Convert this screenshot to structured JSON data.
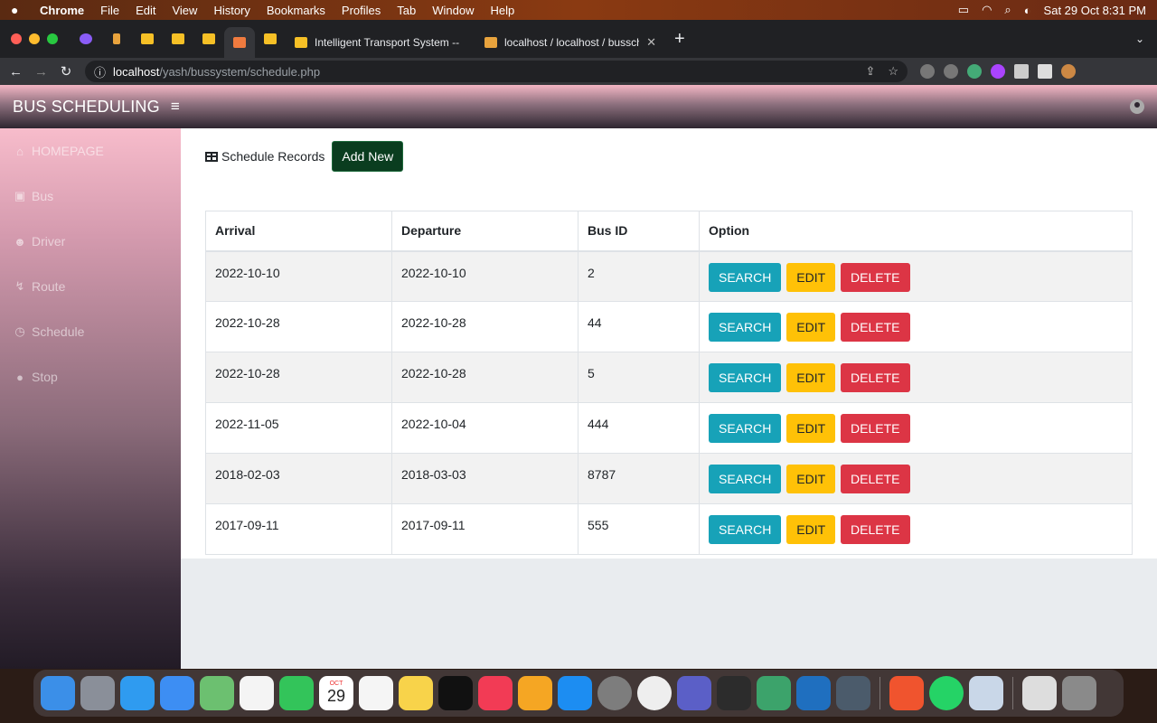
{
  "menubar": {
    "app": "Chrome",
    "items": [
      "File",
      "Edit",
      "View",
      "History",
      "Bookmarks",
      "Profiles",
      "Tab",
      "Window",
      "Help"
    ],
    "datetime": "Sat 29 Oct  8:31 PM"
  },
  "browser": {
    "tabs": [
      {
        "title": "Intelligent Transport System --"
      },
      {
        "title": "localhost / localhost / bussche"
      }
    ],
    "url_host": "localhost",
    "url_path": "/yash/bussystem/schedule.php"
  },
  "app": {
    "brand": "BUS SCHEDULING",
    "hamburger": "≡",
    "sidebar": [
      {
        "label": "HOMEPAGE",
        "icon": "⌂"
      },
      {
        "label": "Bus",
        "icon": "▣"
      },
      {
        "label": "Driver",
        "icon": "☻"
      },
      {
        "label": "Route",
        "icon": "↯"
      },
      {
        "label": "Schedule",
        "icon": "◷"
      },
      {
        "label": "Stop",
        "icon": "●"
      }
    ],
    "records_title": "Schedule Records",
    "add_new": "Add New",
    "table": {
      "headers": [
        "Arrival",
        "Departure",
        "Bus ID",
        "Option"
      ],
      "rows": [
        [
          "2022-10-10",
          "2022-10-10",
          "2"
        ],
        [
          "2022-10-28",
          "2022-10-28",
          "44"
        ],
        [
          "2022-10-28",
          "2022-10-28",
          "5"
        ],
        [
          "2022-11-05",
          "2022-10-04",
          "444"
        ],
        [
          "2018-02-03",
          "2018-03-03",
          "8787"
        ],
        [
          "2017-09-11",
          "2017-09-11",
          "555"
        ]
      ],
      "buttons": {
        "search": "SEARCH",
        "edit": "EDIT",
        "delete": "DELETE"
      }
    }
  },
  "dock": {
    "calendar_month": "OCT",
    "calendar_day": "29"
  }
}
